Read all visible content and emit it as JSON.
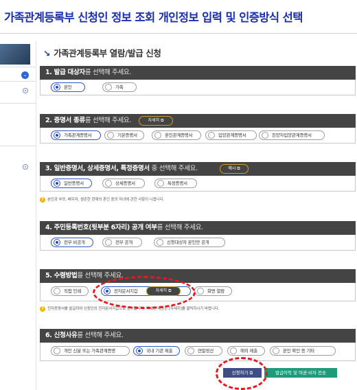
{
  "page": {
    "title": "가족관계등록부 신청인 정보 조회 개인정보 입력 및 인증방식 선택"
  },
  "section": {
    "heading": "가족관계등록부 열람/발급 신청"
  },
  "sections": [
    {
      "title_bold": "1. 발급 대상자",
      "title_rest": "를 선택해 주세요.",
      "options": [
        "본인",
        "가족"
      ],
      "selected": "본인"
    },
    {
      "title_bold": "2. 증명서 종류",
      "title_rest": "를 선택해 주세요.",
      "help_label": "자세히 ⧉",
      "options": [
        "가족관계증명서",
        "기본증명서",
        "혼인관계증명서",
        "입양관계증명서",
        "친양자입양관계증명서"
      ],
      "selected": "가족관계증명서"
    },
    {
      "title_bold": "3. 일반증명서, 상세증명서, 특정증명서",
      "title_rest": " 중 선택해 주세요.",
      "help_label": "예시 ⧉",
      "options": [
        "일반증명서",
        "상세증명서",
        "특정증명서"
      ],
      "selected": "일반증명서",
      "note": "본인과 부모, 배우자, 생존한 현재의 혼인 중의 자녀에 관한 사항이 나옵니다."
    },
    {
      "title_bold": "4. 주민등록번호(뒷부분 6자리) 공개 여부",
      "title_rest": "를 선택해 주세요.",
      "options": [
        "전부 비공개",
        "전부 공개",
        "신청대상자 본인만 공개"
      ],
      "selected": "전부 비공개"
    },
    {
      "title_bold": "5. 수령방법",
      "title_rest": "을 선택해 주세요.",
      "options": [
        "직접 인쇄",
        "전자문서지갑",
        "화면 열람"
      ],
      "selected": "전자문서지갑",
      "inline_button": "자세히 ⧉",
      "note": "전자증명서를 발급하여 신청인의 전자문서지갑으로 송부합니다. 자세한 내용은 [자세히]를 클릭하시기 바랍니다."
    },
    {
      "title_bold": "6. 신청사유",
      "title_rest": "를 선택해 주세요.",
      "options": [
        "개인 신분 또는 가족관계증명",
        "국내 기관 제출",
        "연말정산",
        "해외 제출",
        "본인 확인 등 기타"
      ],
      "selected": "국내 기관 제출"
    }
  ],
  "actions": {
    "apply_label": "신청하기 ⧉",
    "print_label": "발급이력 및 여권·비자 전송"
  },
  "icons": {
    "heading_arrow": "↘",
    "note_icon": "?",
    "sidebar_chevron": "⌄"
  },
  "colors": {
    "title": "#1b2fb0",
    "panel_bar": "#444444",
    "selected": "#1f49c2",
    "highlight": "#e3191f",
    "print_button": "#1f9a7a",
    "apply_button": "#3f4d86"
  }
}
